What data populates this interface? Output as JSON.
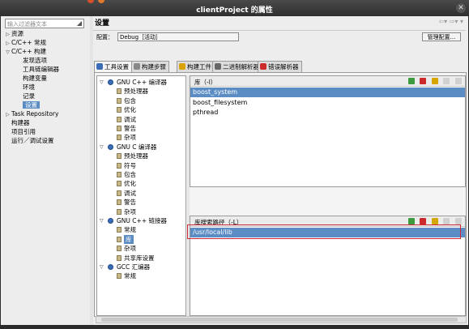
{
  "window": {
    "title": "clientProject 的属性"
  },
  "left": {
    "filter_placeholder": "输入过滤器文本",
    "tree": [
      {
        "label": "资源",
        "arrow": "▷",
        "indent": 0
      },
      {
        "label": "C/C++ 常规",
        "arrow": "▷",
        "indent": 0
      },
      {
        "label": "C/C++ 构建",
        "arrow": "▽",
        "indent": 0
      },
      {
        "label": "发现选项",
        "arrow": "",
        "indent": 1
      },
      {
        "label": "工具链编辑器",
        "arrow": "",
        "indent": 1
      },
      {
        "label": "构建变量",
        "arrow": "",
        "indent": 1
      },
      {
        "label": "环境",
        "arrow": "",
        "indent": 1
      },
      {
        "label": "记录",
        "arrow": "",
        "indent": 1
      },
      {
        "label": "设置",
        "arrow": "",
        "indent": 1,
        "selected": true
      },
      {
        "label": "Task Repository",
        "arrow": "▷",
        "indent": 0
      },
      {
        "label": "构建器",
        "arrow": "",
        "indent": 0
      },
      {
        "label": "项目引用",
        "arrow": "",
        "indent": 0
      },
      {
        "label": "运行／调试设置",
        "arrow": "",
        "indent": 0
      }
    ]
  },
  "right": {
    "heading": "设置",
    "config_label": "配置：",
    "config_value": "Debug［活动］",
    "manage_label": "管理配置...",
    "tabs": [
      {
        "label": "工具设置",
        "active": true,
        "color": "#3a6db5"
      },
      {
        "label": "构建步骤",
        "color": "#888888"
      },
      {
        "label": "构建工件",
        "color": "#d9a200"
      },
      {
        "label": "二进制解析器",
        "color": "#666666"
      },
      {
        "label": "错误解析器",
        "color": "#cc2a2a"
      }
    ],
    "tool_tree": [
      {
        "label": "GNU C++ 编译器",
        "type": "tool",
        "expanded": true
      },
      {
        "label": "预处理器",
        "type": "leaf"
      },
      {
        "label": "包含",
        "type": "leaf"
      },
      {
        "label": "优化",
        "type": "leaf"
      },
      {
        "label": "调试",
        "type": "leaf"
      },
      {
        "label": "警告",
        "type": "leaf"
      },
      {
        "label": "杂项",
        "type": "leaf"
      },
      {
        "label": "GNU C 编译器",
        "type": "tool",
        "expanded": true
      },
      {
        "label": "预处理器",
        "type": "leaf"
      },
      {
        "label": "符号",
        "type": "leaf"
      },
      {
        "label": "包含",
        "type": "leaf"
      },
      {
        "label": "优化",
        "type": "leaf"
      },
      {
        "label": "调试",
        "type": "leaf"
      },
      {
        "label": "警告",
        "type": "leaf"
      },
      {
        "label": "杂项",
        "type": "leaf"
      },
      {
        "label": "GNU C++ 链接器",
        "type": "tool",
        "expanded": true
      },
      {
        "label": "常规",
        "type": "leaf"
      },
      {
        "label": "库",
        "type": "leaf",
        "selected": true
      },
      {
        "label": "杂项",
        "type": "leaf"
      },
      {
        "label": "共享库设置",
        "type": "leaf"
      },
      {
        "label": "GCC 汇编器",
        "type": "tool",
        "expanded": true
      },
      {
        "label": "常规",
        "type": "leaf"
      }
    ],
    "libraries": {
      "title": "库（-l）",
      "items": [
        "boost_system",
        "boost_filesystem",
        "pthread"
      ],
      "selected_index": 0
    },
    "library_paths": {
      "title": "库搜索路径（-L）",
      "items": [
        "/usr/local/lib"
      ],
      "selected_index": 0
    }
  },
  "colors": {
    "selection": "#5b8cc4",
    "highlight_box": "#d0263a"
  }
}
